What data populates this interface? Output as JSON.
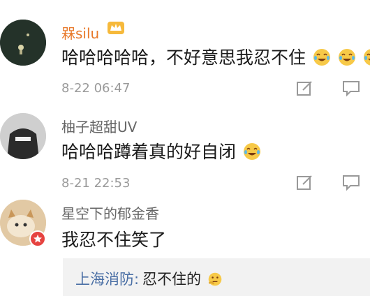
{
  "comments": [
    {
      "username": "槑silu",
      "text": "哈哈哈哈哈，不好意思我忍不住",
      "time": "8-22 06:47",
      "emoji": "laughing-crying-emoji"
    },
    {
      "username": "柚子超甜UV",
      "text": "哈哈哈蹲着真的好自闭",
      "time": "8-21 22:53",
      "emoji": "laughing-crying-emoji"
    },
    {
      "username": "星空下的郁金香",
      "text": "我忍不住笑了"
    }
  ],
  "reply": {
    "name": "上海消防:",
    "text": "忍不住的",
    "emoji": "thinking-emoji"
  },
  "colors": {
    "username_orange": "#e8792a",
    "username_gray": "#666666",
    "reply_blue": "#4a6fa5",
    "time_gray": "#9a9a9a"
  }
}
